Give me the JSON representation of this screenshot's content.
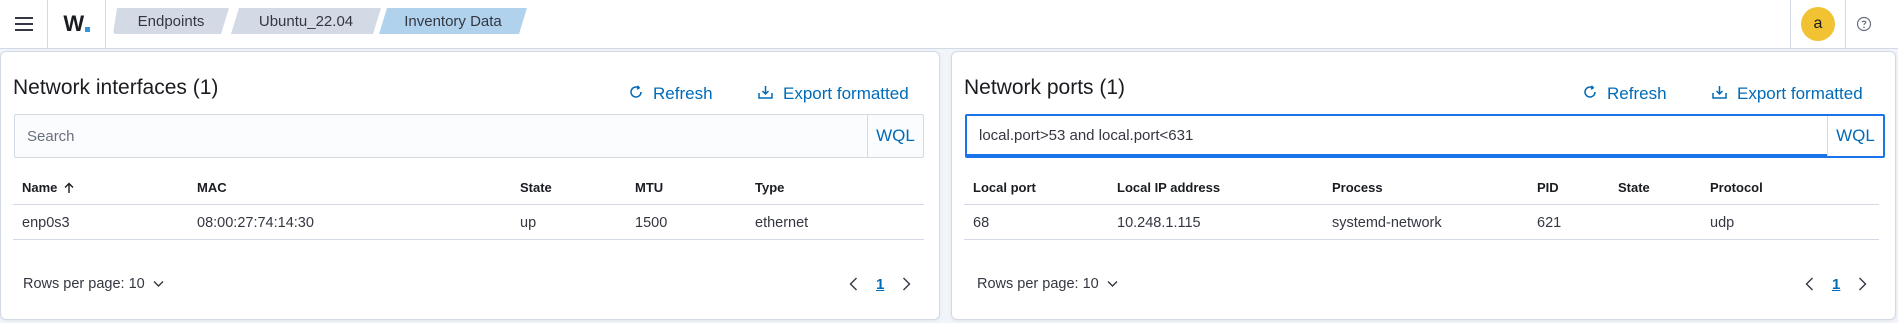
{
  "header": {
    "menu_icon": "hamburger-menu-icon",
    "logo": "W",
    "breadcrumbs": [
      "Endpoints",
      "Ubuntu_22.04",
      "Inventory Data"
    ],
    "avatar_letter": "a",
    "help_icon": "help-icon",
    "colors": {
      "accent": "#006bb8",
      "avatar": "#f1c232",
      "crumb_active": "#b0d2ed"
    }
  },
  "network_interfaces": {
    "title": "Network interfaces (1)",
    "refresh_label": "Refresh",
    "export_label": "Export formatted",
    "search_placeholder": "Search",
    "search_value": "",
    "wql_label": "WQL",
    "columns": [
      "Name",
      "MAC",
      "State",
      "MTU",
      "Type"
    ],
    "sort_column": "Name",
    "rows": [
      [
        "enp0s3",
        "08:00:27:74:14:30",
        "up",
        "1500",
        "ethernet"
      ]
    ],
    "rows_per_page_label": "Rows per page: 10",
    "current_page": "1"
  },
  "network_ports": {
    "title": "Network ports (1)",
    "refresh_label": "Refresh",
    "export_label": "Export formatted",
    "search_placeholder": "",
    "search_value": "local.port>53 and local.port<631",
    "wql_label": "WQL",
    "columns": [
      "Local port",
      "Local IP address",
      "Process",
      "PID",
      "State",
      "Protocol"
    ],
    "rows": [
      [
        "68",
        "10.248.1.115",
        "systemd-network",
        "621",
        "",
        "udp"
      ]
    ],
    "rows_per_page_label": "Rows per page: 10",
    "current_page": "1"
  }
}
